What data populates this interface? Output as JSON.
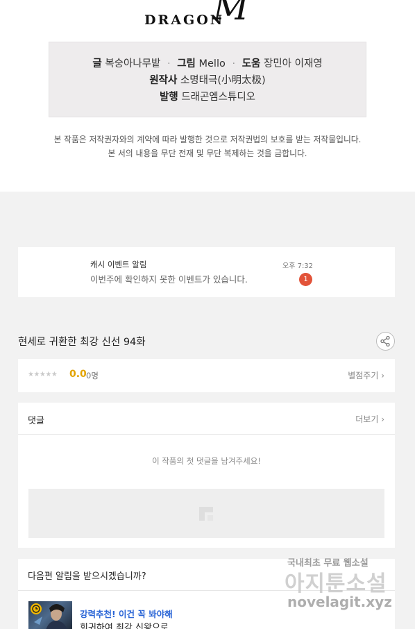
{
  "logo": {
    "text": "DRAGON",
    "mark": "M"
  },
  "credits": {
    "line1": [
      {
        "label": "글",
        "value": "복숭아나무밭"
      },
      {
        "label": "그림",
        "value": "Mello"
      },
      {
        "label": "도움",
        "value": "장민아 이재영"
      }
    ],
    "line2": {
      "label": "원작사",
      "value": "소명태극(小明太极)"
    },
    "line3": {
      "label": "발행",
      "value": "드래곤엠스튜디오"
    },
    "separator": "·"
  },
  "notice": {
    "line1": "본 작품은 저작권자와의 계약에 따라 발행한 것으로 저작권법의 보호를 받는 저작물입니다.",
    "line2": "본 서의 내용을 무단 전재 및 무단 복제하는 것을 금합니다."
  },
  "event": {
    "title": "캐시 이벤트 알림",
    "message": "이번주에 확인하지 못한 이벤트가 있습니다.",
    "time": "오후 7:32",
    "badge": "1"
  },
  "episode": {
    "title": "현세로 귀환한 최강 신선 94화",
    "share_icon": "share-icon"
  },
  "rating": {
    "stars": "★★★★★",
    "score": "0.0",
    "count": "0명",
    "rate_link": "별점주기 ›"
  },
  "comments": {
    "title": "댓글",
    "more_link": "더보기 ›",
    "empty_message": "이 작품의 첫 댓글을 남겨주세요!"
  },
  "next": {
    "title": "다음편 알림을 받으시겠습니까?",
    "recommend_title": "강력추천! 이건 꼭 봐야해",
    "recommend_sub": "회귀하여 최강 신왕으로"
  },
  "watermark": {
    "line1": "국내최초 무료 웹소설",
    "line2": "아지툰소설",
    "line3": "novelagit.xyz"
  },
  "colors": {
    "score": "#e2a300",
    "badge": "#e25339",
    "link_blue": "#2a65d6",
    "background": "#f2f2f2"
  }
}
